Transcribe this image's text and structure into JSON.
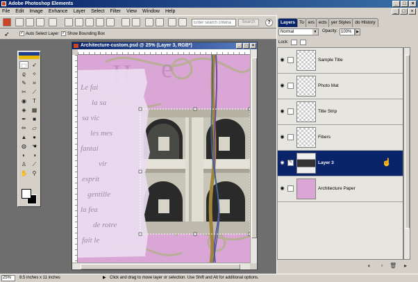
{
  "app": {
    "title": "Adobe Photoshop Elements",
    "window_buttons": [
      "_",
      "□",
      "×"
    ]
  },
  "menu": [
    "File",
    "Edit",
    "Image",
    "Enhance",
    "Layer",
    "Select",
    "Filter",
    "View",
    "Window",
    "Help"
  ],
  "shortcuts": {
    "search_placeholder": "Enter search criteria",
    "search_button": "Search",
    "help_icon": "?",
    "icons": [
      "adobe-logo-icon",
      "new-icon",
      "open-icon",
      "browse-icon",
      "save-icon",
      "email-icon",
      "print-icon",
      "print-preview-icon",
      "online-services-icon",
      "web-photo-gallery-icon",
      "cut-icon",
      "copy-icon",
      "paste-icon",
      "step-backward-icon",
      "step-forward-icon",
      "quick-fix-icon",
      "help-search-icon"
    ]
  },
  "options": {
    "tool_icon": "move-tool-icon",
    "auto_select_label": "Auto Select Layer",
    "auto_select_checked": true,
    "bounding_box_label": "Show Bounding Box",
    "bounding_box_checked": true
  },
  "document": {
    "title": "Architecture-custom.psd @ 25% (Layer 3, RGB*)",
    "canvas_colors": {
      "paper": "#d9a6d5",
      "torn_paper": "#eadcf0",
      "stone": "#c7c4b8",
      "arch_dark": "#2a2a2a"
    },
    "script_text": [
      "Le fai",
      "la sa",
      "sa vic",
      "les mes",
      "fantai",
      "vir",
      "esprit",
      "gentille",
      "la fea",
      "de rotre",
      "fait le"
    ]
  },
  "toolbox": {
    "tools": [
      "move-tool-icon",
      "zoom-tool-icon",
      "marquee-tool-icon",
      "hand-tool-icon",
      "lasso-tool-icon",
      "eyedropper-tool-icon",
      "magic-wand-tool-icon",
      "crop-tool-icon",
      "selection-brush-tool-icon",
      "type-tool-icon",
      "cookie-cutter-tool-icon",
      "red-eye-tool-icon",
      "paint-bucket-tool-icon",
      "gradient-tool-icon",
      "shape-tool-icon",
      "brush-tool-icon",
      "pencil-tool-icon",
      "eraser-tool-icon",
      "blur-tool-icon",
      "sharpen-tool-icon",
      "sponge-tool-icon",
      "dodge-tool-icon",
      "clone-stamp-tool-icon",
      "pattern-stamp-tool-icon",
      "smudge-tool-icon",
      "burn-tool-icon"
    ],
    "foreground": "#ffffff",
    "background": "#000000"
  },
  "layers_panel": {
    "tabs": [
      "Layers",
      "To",
      "ers",
      "ects",
      "yer Styles",
      "do History"
    ],
    "blend_mode": "Normal",
    "opacity_label": "Opacity:",
    "opacity_value": "100%",
    "lock_label": "Lock:",
    "layers": [
      {
        "name": "Sample Title",
        "visible": true,
        "selected": false,
        "thumb": "transparent"
      },
      {
        "name": "Photo Mat",
        "visible": true,
        "selected": false,
        "thumb": "transparent"
      },
      {
        "name": "Title Strip",
        "visible": true,
        "selected": false,
        "thumb": "transparent"
      },
      {
        "name": "Fibers",
        "visible": true,
        "selected": false,
        "thumb": "transparent"
      },
      {
        "name": "Layer 3",
        "visible": true,
        "selected": true,
        "thumb": "image"
      },
      {
        "name": "Architecture Paper",
        "visible": true,
        "selected": false,
        "thumb": "pink"
      }
    ],
    "bottom_icons": [
      "adjustment-layer-icon",
      "new-layer-icon",
      "trash-icon",
      "more-icon"
    ],
    "selected_color": "#0a246a"
  },
  "status": {
    "zoom": "25%",
    "doc_size": "8.5 inches x 11 inches",
    "arrow": "▶",
    "message": "Click and drag to move layer or selection. Use Shift and Alt for additional options."
  }
}
